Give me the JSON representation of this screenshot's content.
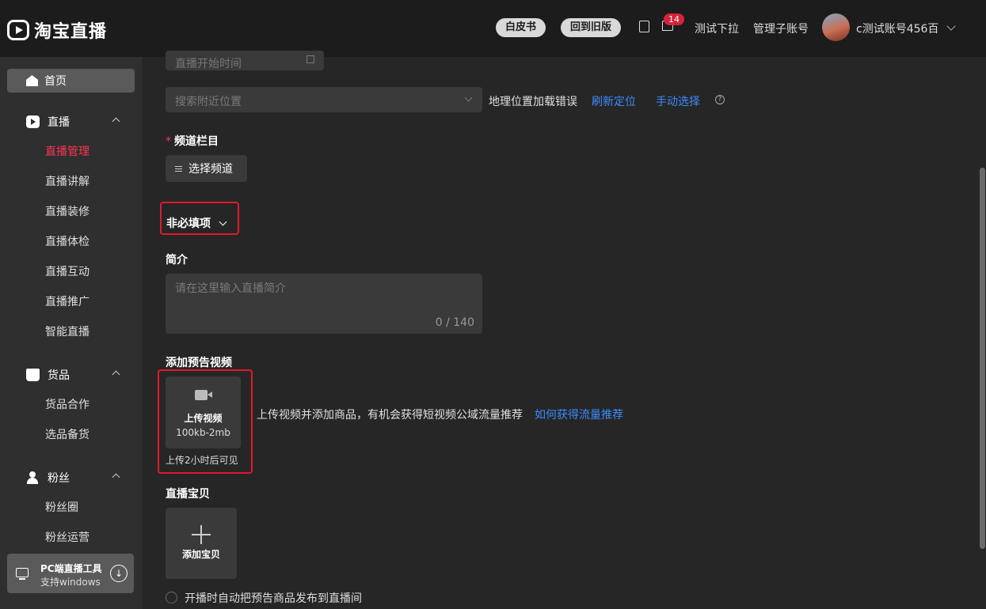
{
  "header": {
    "logo_text": "淘宝直播",
    "btn_whitebook": "白皮书",
    "btn_old_version": "回到旧版",
    "message_count": "14",
    "link_test_dropdown": "测试下拉",
    "link_manage_sub": "管理子账号",
    "account_name": "c测试账号456百"
  },
  "sidebar": {
    "home": "首页",
    "groups": [
      {
        "label": "直播",
        "items": [
          "直播管理",
          "直播讲解",
          "直播装修",
          "直播体检",
          "直播互动",
          "直播推广",
          "智能直播"
        ]
      },
      {
        "label": "货品",
        "items": [
          "货品合作",
          "选品备货"
        ]
      },
      {
        "label": "粉丝",
        "items": [
          "粉丝圈",
          "粉丝运营"
        ]
      }
    ],
    "active_item": "直播管理",
    "tool_title": "PC端直播工具",
    "tool_sub": "支持windows"
  },
  "form": {
    "start_time_placeholder": "直播开始时间",
    "location_placeholder": "搜索附近位置",
    "location_error": "地理位置加载错误",
    "refresh_location": "刷新定位",
    "manual_select": "手动选择",
    "channel_label": "频道栏目",
    "channel_button": "选择频道",
    "optional_toggle": "非必填项",
    "intro_label": "简介",
    "intro_placeholder": "请在这里输入直播简介",
    "intro_counter": "0 / 140",
    "preview_video_label": "添加预告视频",
    "upload_video": "上传视频",
    "upload_size": "100kb-2mb",
    "upload_visible_note": "上传2小时后可见",
    "upload_hint": "上传视频并添加商品，有机会获得短视频公域流量推荐",
    "upload_hint_link": "如何获得流量推荐",
    "baby_label": "直播宝贝",
    "add_baby": "添加宝贝",
    "auto_publish": "开播时自动把预告商品发布到直播间"
  },
  "colors": {
    "accent_red": "#ff3355",
    "link_blue": "#3d8bff",
    "highlight_red": "#e0192f"
  }
}
